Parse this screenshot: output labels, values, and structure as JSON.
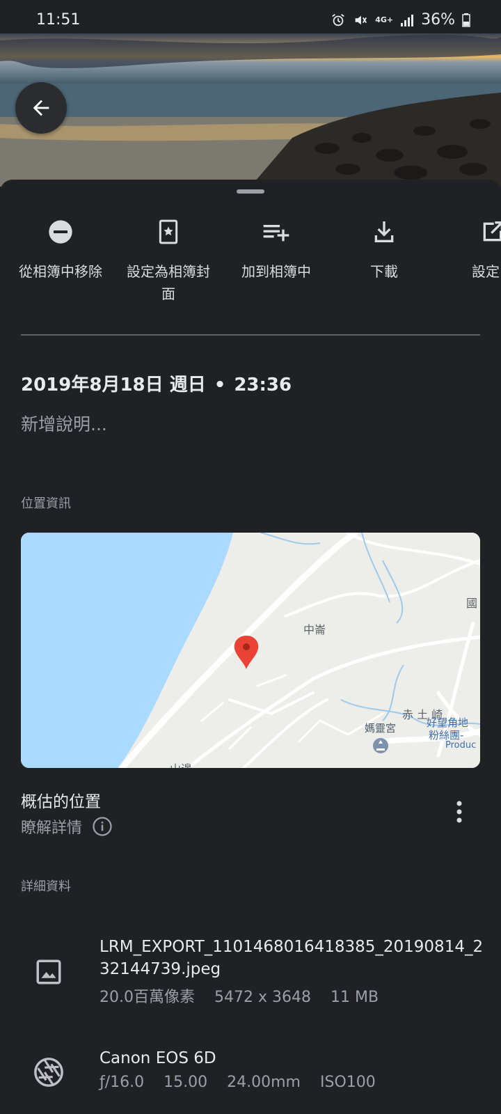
{
  "status": {
    "time": "11:51",
    "network": "4G+",
    "battery": "36%"
  },
  "actions": [
    {
      "label": "從相簿中移除",
      "icon": "remove-circle-icon"
    },
    {
      "label": "設定為相簿封面",
      "icon": "album-cover-icon"
    },
    {
      "label": "加到相簿中",
      "icon": "playlist-add-icon"
    },
    {
      "label": "下載",
      "icon": "download-icon"
    },
    {
      "label": "設定",
      "icon": "edit-icon"
    }
  ],
  "photo": {
    "date": "2019年8月18日 週日",
    "separator": "•",
    "time": "23:36",
    "description_placeholder": "新增說明..."
  },
  "location": {
    "section_label": "位置資訊",
    "map_labels": {
      "village": "中崙",
      "chitu": "赤 土 崎",
      "temple": "媽靈宮",
      "viewpoint": "好望角地",
      "fans": "粉絲團-",
      "produce": "Produc",
      "shanbian": "山邊",
      "box": "國"
    },
    "title": "概估的位置",
    "learn_more": "瞭解詳情"
  },
  "details": {
    "section_label": "詳細資料",
    "file": {
      "name": "LRM_EXPORT_1101468016418385_20190814_232144739.jpeg",
      "megapixels": "20.0百萬像素",
      "resolution": "5472 x 3648",
      "size": "11 MB"
    },
    "camera": {
      "model": "Canon EOS 6D",
      "aperture": "ƒ/16.0",
      "exposure": "15.00",
      "focal_length": "24.00mm",
      "iso": "ISO100"
    }
  },
  "colors": {
    "background": "#202124",
    "water": "#aadaff",
    "pin": "#ea4335"
  }
}
